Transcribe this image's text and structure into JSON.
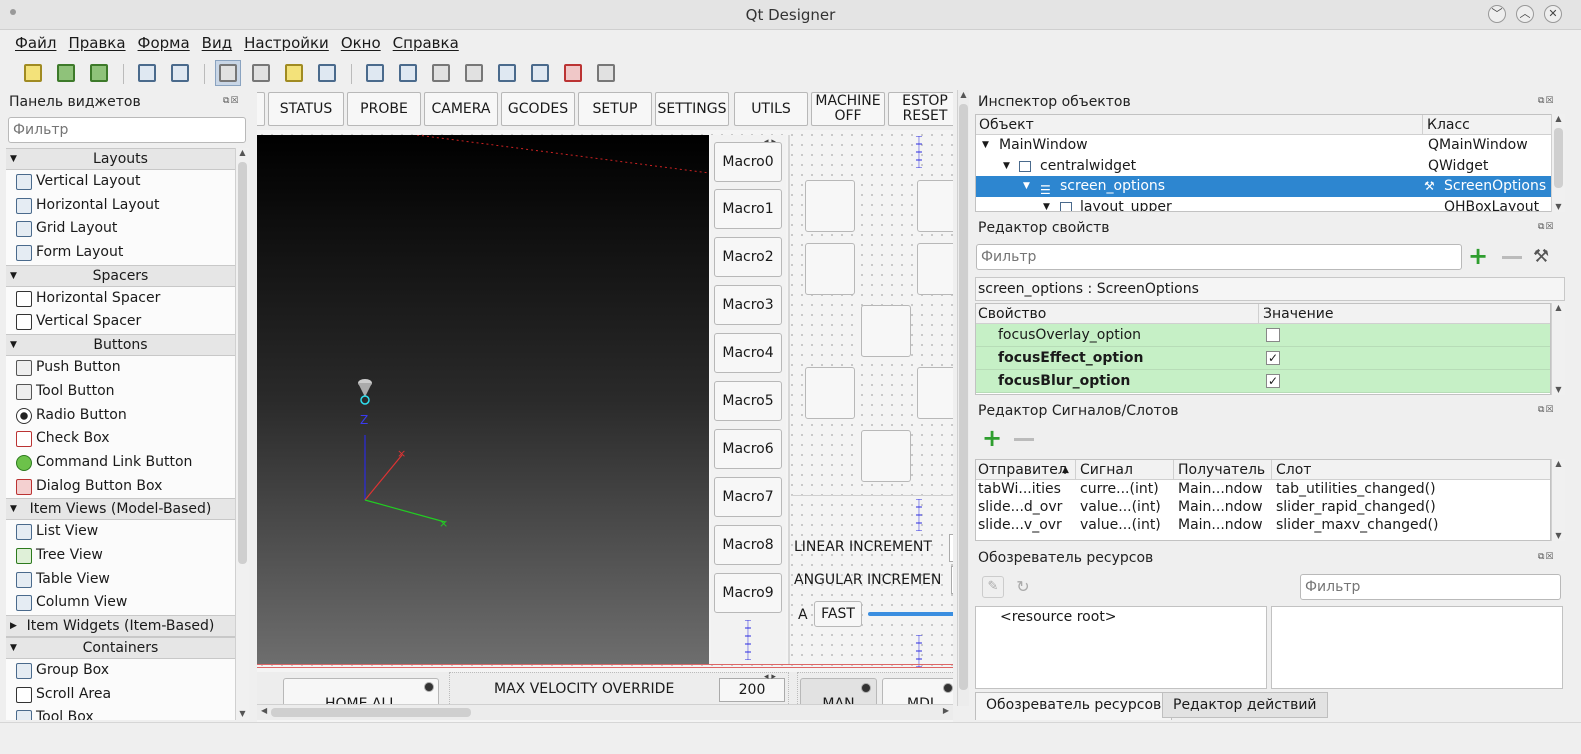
{
  "window": {
    "title": "Qt Designer"
  },
  "menu": [
    "Файл",
    "Правка",
    "Форма",
    "Вид",
    "Настройки",
    "Окно",
    "Справка"
  ],
  "widget_box": {
    "title": "Панель виджетов",
    "filter_placeholder": "Фильтр",
    "categories": [
      {
        "name": "Layouts",
        "items": [
          "Vertical Layout",
          "Horizontal Layout",
          "Grid Layout",
          "Form Layout"
        ]
      },
      {
        "name": "Spacers",
        "items": [
          "Horizontal Spacer",
          "Vertical Spacer"
        ]
      },
      {
        "name": "Buttons",
        "items": [
          "Push Button",
          "Tool Button",
          "Radio Button",
          "Check Box",
          "Command Link Button",
          "Dialog Button Box"
        ]
      },
      {
        "name": "Item Views (Model-Based)",
        "items": [
          "List View",
          "Tree View",
          "Table View",
          "Column View"
        ]
      },
      {
        "name": "Item Widgets (Item-Based)",
        "items": []
      },
      {
        "name": "Containers",
        "items": [
          "Group Box",
          "Scroll Area",
          "Tool Box"
        ]
      }
    ]
  },
  "form": {
    "tabs": [
      "STATUS",
      "PROBE",
      "CAMERA",
      "GCODES",
      "SETUP",
      "SETTINGS",
      "UTILS"
    ],
    "machine_off": [
      "MACHINE",
      "OFF"
    ],
    "estop_reset": [
      "ESTOP",
      "RESET"
    ],
    "macros": [
      "Macro0",
      "Macro1",
      "Macro2",
      "Macro3",
      "Macro4",
      "Macro5",
      "Macro6",
      "Macro7",
      "Macro8",
      "Macro9"
    ],
    "axis_label": "Z",
    "linear_increment": "LINEAR INCREMENT",
    "angular_increment": "ANGULAR INCREMEN",
    "a_label": "A",
    "fast_label": "FAST",
    "home_all": "HOME ALL",
    "max_velocity": "MAX VELOCITY OVERRIDE",
    "max_velocity_value": "200",
    "man": "MAN",
    "mdi": "MDI"
  },
  "object_inspector": {
    "title": "Инспектор объектов",
    "col_object": "Объект",
    "col_class": "Класс",
    "rows": [
      {
        "name": "MainWindow",
        "cls": "QMainWindow"
      },
      {
        "name": "centralwidget",
        "cls": "QWidget"
      },
      {
        "name": "screen_options",
        "cls": "ScreenOptions"
      },
      {
        "name": "layout_upper",
        "cls": "QHBoxLayout"
      }
    ]
  },
  "property_editor": {
    "title": "Редактор свойств",
    "filter_placeholder": "Фильтр",
    "object_label": "screen_options : ScreenOptions",
    "col_property": "Свойство",
    "col_value": "Значение",
    "rows": [
      {
        "name": "focusOverlay_option",
        "checked": "",
        "bold": false
      },
      {
        "name": "focusEffect_option",
        "checked": "✓",
        "bold": true
      },
      {
        "name": "focusBlur_option",
        "checked": "✓",
        "bold": true
      }
    ]
  },
  "signal_slot_editor": {
    "title": "Редактор Сигналов/Слотов",
    "cols": [
      "Отправител",
      "Сигнал",
      "Получатель",
      "Слот"
    ],
    "rows": [
      [
        "tabWi...ities",
        "curre...(int)",
        "Main...ndow",
        "tab_utilities_changed()"
      ],
      [
        "slide...d_ovr",
        "value...(int)",
        "Main...ndow",
        "slider_rapid_changed()"
      ],
      [
        "slide...v_ovr",
        "value...(int)",
        "Main...ndow",
        "slider_maxv_changed()"
      ]
    ]
  },
  "resource_browser": {
    "title": "Обозреватель ресурсов",
    "filter_placeholder": "Фильтр",
    "root": "<resource root>",
    "tabs": [
      "Обозреватель ресурсов",
      "Редактор действий"
    ]
  }
}
